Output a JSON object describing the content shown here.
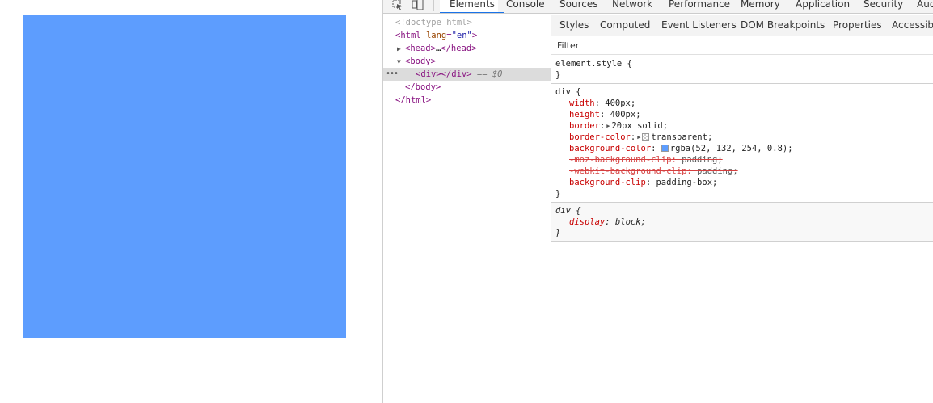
{
  "preview": {
    "box_color": "#5d9dfe"
  },
  "topbar": {
    "tabs": [
      "Elements",
      "Console",
      "Sources",
      "Network",
      "Performance",
      "Memory",
      "Application",
      "Security",
      "Aud"
    ],
    "active_tab": "Elements",
    "accent": "#1a73e8"
  },
  "tree": {
    "doctype": "<!doctype html>",
    "html_tag": "html",
    "html_attr": "lang",
    "html_attr_val": "\"en\"",
    "head_open": "<head>",
    "head_ellipsis": "…",
    "head_close": "</head>",
    "body_open": "<body>",
    "div_open": "<div>",
    "div_close": "</div>",
    "selected_marker": "== $0",
    "body_close": "</body>",
    "html_close": "</html>",
    "dots": "•••"
  },
  "pane": {
    "subtabs": [
      "Styles",
      "Computed",
      "Event Listeners",
      "DOM Breakpoints",
      "Properties",
      "Accessibil"
    ],
    "active_subtab": "Styles",
    "filter_placeholder": "Filter"
  },
  "rules": {
    "element_style": {
      "selector": "element.style {",
      "close": "}"
    },
    "div_rule": {
      "selector": "div {",
      "close": "}",
      "decls": [
        {
          "prop": "width",
          "value": "400px;"
        },
        {
          "prop": "height",
          "value": "400px;"
        },
        {
          "prop": "border",
          "value": "20px solid;"
        },
        {
          "prop": "border-color",
          "value": "transparent;"
        },
        {
          "prop": "background-color",
          "value": "rgba(52, 132, 254, 0.8);"
        },
        {
          "prop": "-moz-background-clip",
          "value": "padding;"
        },
        {
          "prop": "-webkit-background-clip",
          "value": "padding;"
        },
        {
          "prop": "background-clip",
          "value": "padding-box;"
        }
      ],
      "swatch_color": "#5d9dfe"
    },
    "ua_rule": {
      "selector": "div {",
      "close": "}",
      "decls": [
        {
          "prop": "display",
          "value": "block;"
        }
      ]
    }
  }
}
